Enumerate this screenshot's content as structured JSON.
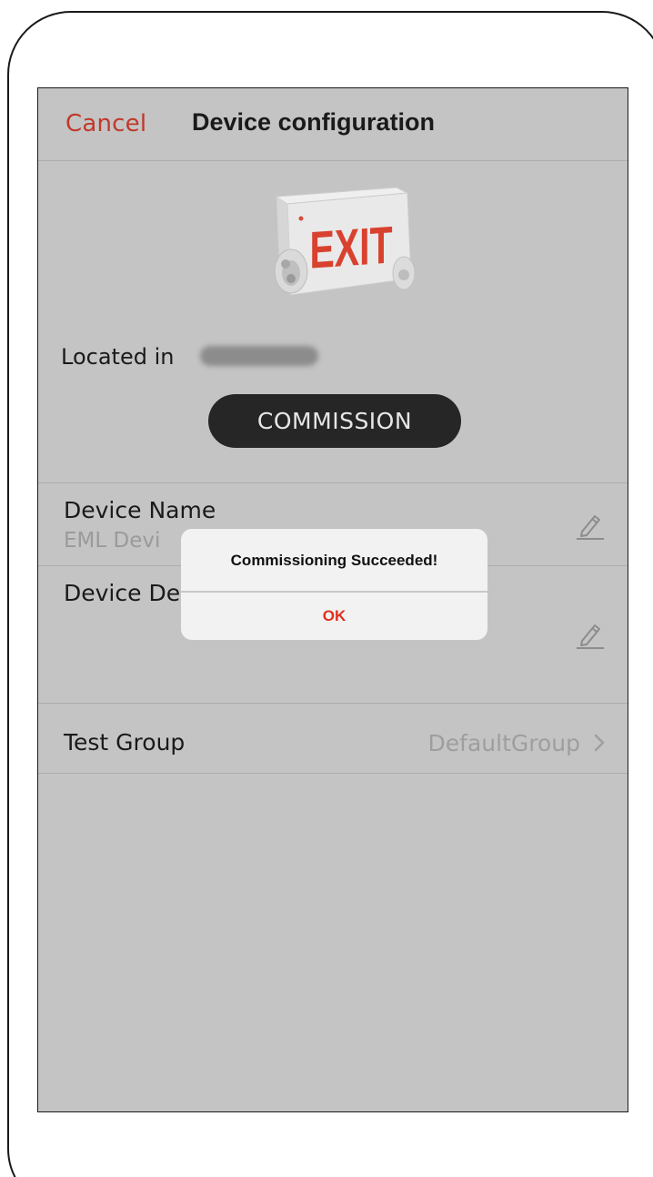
{
  "nav": {
    "cancel_label": "Cancel",
    "title": "Device configuration"
  },
  "device": {
    "image_icon": "exit-sign-icon",
    "sign_text": "EXIT",
    "located_label": "Located in",
    "located_value": "",
    "commission_label": "COMMISSION"
  },
  "fields": {
    "name_label": "Device Name",
    "name_value": "EML Devi",
    "desc_label": "Device De",
    "desc_value": "",
    "test_group_label": "Test Group",
    "test_group_value": "DefaultGroup"
  },
  "alert": {
    "title": "Commissioning Succeeded!",
    "ok_label": "OK"
  },
  "icons": {
    "edit": "pencil-icon",
    "chevron": "chevron-right-icon"
  },
  "colors": {
    "accent": "#c0392b",
    "alert_ok": "#e0301e",
    "screen_bg": "#c4c4c4",
    "button_bg": "#262626"
  }
}
